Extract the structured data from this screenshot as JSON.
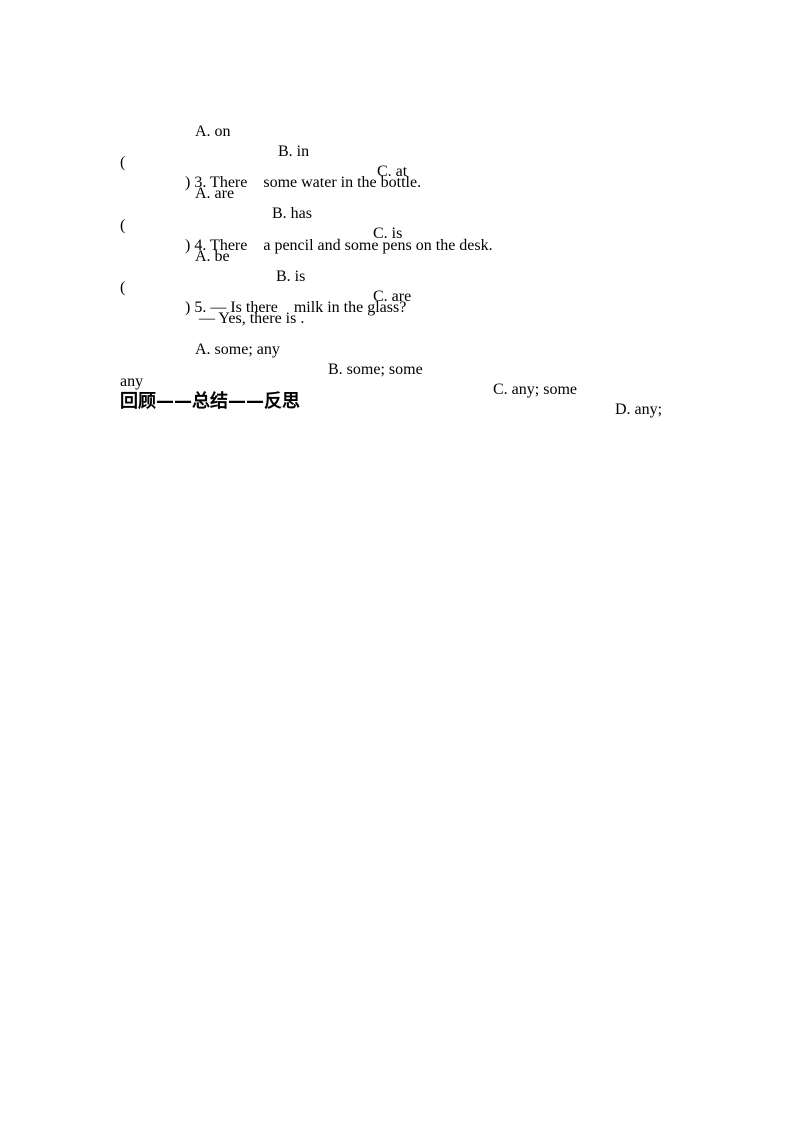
{
  "q2_options": {
    "a": "A. on",
    "b": "B. in",
    "c": "C. at"
  },
  "q3": {
    "open_paren": "(",
    "stem": ") 3. There    some water in the bottle.",
    "options": {
      "a": "A. are",
      "b": "B. has",
      "c": "C. is"
    }
  },
  "q4": {
    "open_paren": "(",
    "stem": ") 4. There    a pencil and some pens on the desk.",
    "options": {
      "a": "A. be",
      "b": "B. is",
      "c": "C. are"
    }
  },
  "q5": {
    "open_paren": "(",
    "stem": ") 5. — Is there    milk in the glass?",
    "reply": "— Yes, there is .",
    "options": {
      "a": "A. some; any",
      "b": "B. some; some",
      "c": "C. any; some",
      "d": "D. any;"
    },
    "wrap": "any"
  },
  "section_heading": "回顾——总结——反思"
}
